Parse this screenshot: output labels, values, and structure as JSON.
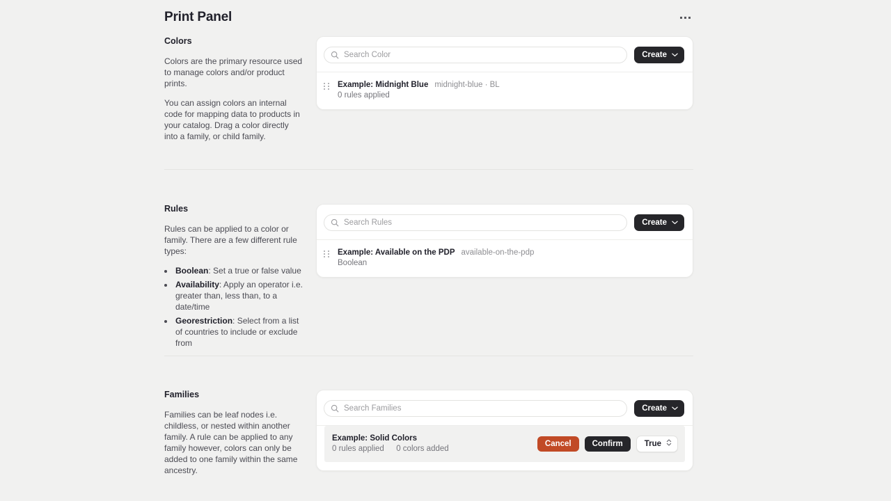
{
  "header": {
    "title": "Print Panel",
    "overflow_label": "More options"
  },
  "sections": [
    {
      "id": "colors",
      "heading": "Colors",
      "paragraphs": [
        "Colors are the primary resource used to manage colors and/or product prints.",
        "You can assign colors an internal code for mapping data to products in your catalog. Drag a color directly into a family, or child family."
      ],
      "search_placeholder": "Search Color",
      "search_value": "",
      "create_label": "Create",
      "row": {
        "title": "Example: Midnight Blue",
        "slug": "midnight-blue · BL",
        "sub": "0 rules applied"
      }
    },
    {
      "id": "rules",
      "heading": "Rules",
      "paragraphs": [
        "Rules can be applied to a color or family. There are a few different rule types:"
      ],
      "bullets": [
        {
          "term": "Boolean",
          "text": ": Set a true or false value"
        },
        {
          "term": "Availability",
          "text": ": Apply an operator i.e. greater than, less than, to a date/time"
        },
        {
          "term": "Georestriction",
          "text": ": Select from a list of countries to include or exclude from"
        }
      ],
      "search_placeholder": "Search Rules",
      "search_value": "",
      "create_label": "Create",
      "row": {
        "title": "Example: Available on the PDP",
        "slug": "available-on-the-pdp",
        "sub": "Boolean"
      }
    },
    {
      "id": "families",
      "heading": "Families",
      "paragraphs": [
        "Families can be leaf nodes i.e. childless, or nested within another family. A rule can be applied to any family however, colors can only be added to one family within the same ancestry."
      ],
      "search_placeholder": "Search Families",
      "search_value": "",
      "create_label": "Create",
      "row": {
        "title": "Example: Solid Colors",
        "sub_rules": "0 rules applied",
        "sub_colors": "0 colors added"
      },
      "actions": {
        "cancel_label": "Cancel",
        "confirm_label": "Confirm",
        "select_value": "True"
      }
    }
  ],
  "colors": {
    "page_background": "#f1f1f0",
    "card_background": "#ffffff",
    "text_primary": "#21212b",
    "text_muted": "#8e8e92",
    "button_dark": "#26262a",
    "button_cancel": "#c14a26",
    "row_highlight": "#f1f1f0"
  },
  "icons": {
    "search": "search-icon",
    "chevron_down": "chevron-down-icon",
    "chevron_updown": "chevron-up-down-icon",
    "drag": "drag-handle-icon",
    "overflow": "ellipsis-icon"
  }
}
